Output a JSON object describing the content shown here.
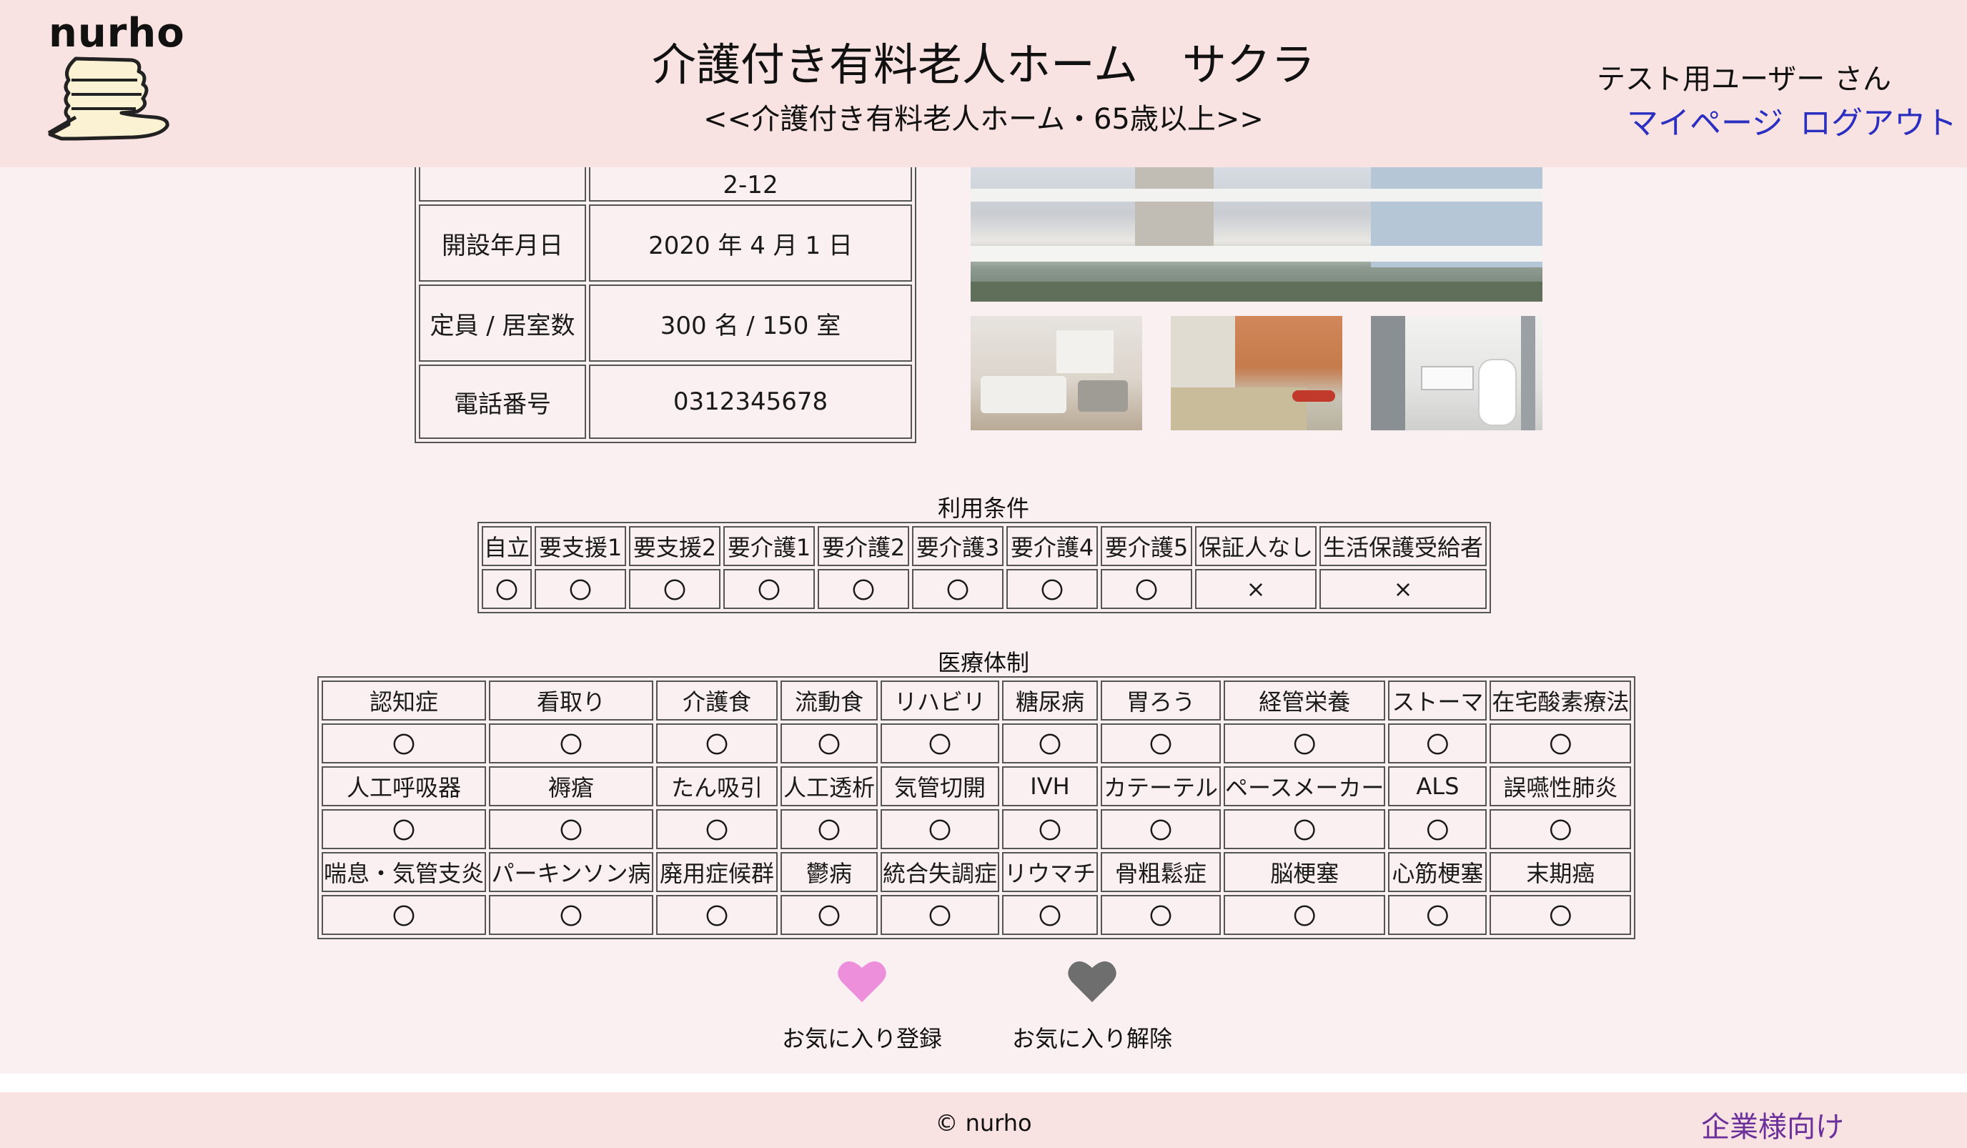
{
  "header": {
    "logo": "nurho",
    "facility_title": "介護付き有料老人ホーム　サクラ",
    "facility_subtitle": "<<介護付き有料老人ホーム・65歳以上>>",
    "user_name": "テスト用ユーザー さん",
    "mypage_label": "マイページ",
    "logout_label": "ログアウト"
  },
  "info": {
    "rows": [
      {
        "label": "",
        "value": "2-12"
      },
      {
        "label": "開設年月日",
        "value": "2020 年 4 月 1 日"
      },
      {
        "label": "定員 / 居室数",
        "value": "300 名 / 150 室"
      },
      {
        "label": "電話番号",
        "value": "0312345678"
      }
    ]
  },
  "photos": [
    "building-exterior-photo",
    "room-photo",
    "bath-photo",
    "toilet-photo"
  ],
  "usage": {
    "title": "利用条件",
    "headers": [
      "自立",
      "要支援1",
      "要支援2",
      "要介護1",
      "要介護2",
      "要介護3",
      "要介護4",
      "要介護5",
      "保証人なし",
      "生活保護受給者"
    ],
    "values": [
      "〇",
      "〇",
      "〇",
      "〇",
      "〇",
      "〇",
      "〇",
      "〇",
      "×",
      "×"
    ]
  },
  "medical": {
    "title": "医療体制",
    "rows": [
      {
        "headers": [
          "認知症",
          "看取り",
          "介護食",
          "流動食",
          "リハビリ",
          "糖尿病",
          "胃ろう",
          "経管栄養",
          "ストーマ",
          "在宅酸素療法"
        ],
        "values": [
          "〇",
          "〇",
          "〇",
          "〇",
          "〇",
          "〇",
          "〇",
          "〇",
          "〇",
          "〇"
        ]
      },
      {
        "headers": [
          "人工呼吸器",
          "褥瘡",
          "たん吸引",
          "人工透析",
          "気管切開",
          "IVH",
          "カテーテル",
          "ペースメーカー",
          "ALS",
          "誤嚥性肺炎"
        ],
        "values": [
          "〇",
          "〇",
          "〇",
          "〇",
          "〇",
          "〇",
          "〇",
          "〇",
          "〇",
          "〇"
        ]
      },
      {
        "headers": [
          "喘息・気管支炎",
          "パーキンソン病",
          "廃用症候群",
          "鬱病",
          "統合失調症",
          "リウマチ",
          "骨粗鬆症",
          "脳梗塞",
          "心筋梗塞",
          "末期癌"
        ],
        "values": [
          "〇",
          "〇",
          "〇",
          "〇",
          "〇",
          "〇",
          "〇",
          "〇",
          "〇",
          "〇"
        ]
      }
    ]
  },
  "favorites": {
    "add_label": "お気に入り登録",
    "remove_label": "お気に入り解除",
    "add_color": "#ee8fdc",
    "remove_color": "#6e6e6e"
  },
  "footer": {
    "copyright": "© nurho",
    "corporate_link": "企業様向け"
  }
}
